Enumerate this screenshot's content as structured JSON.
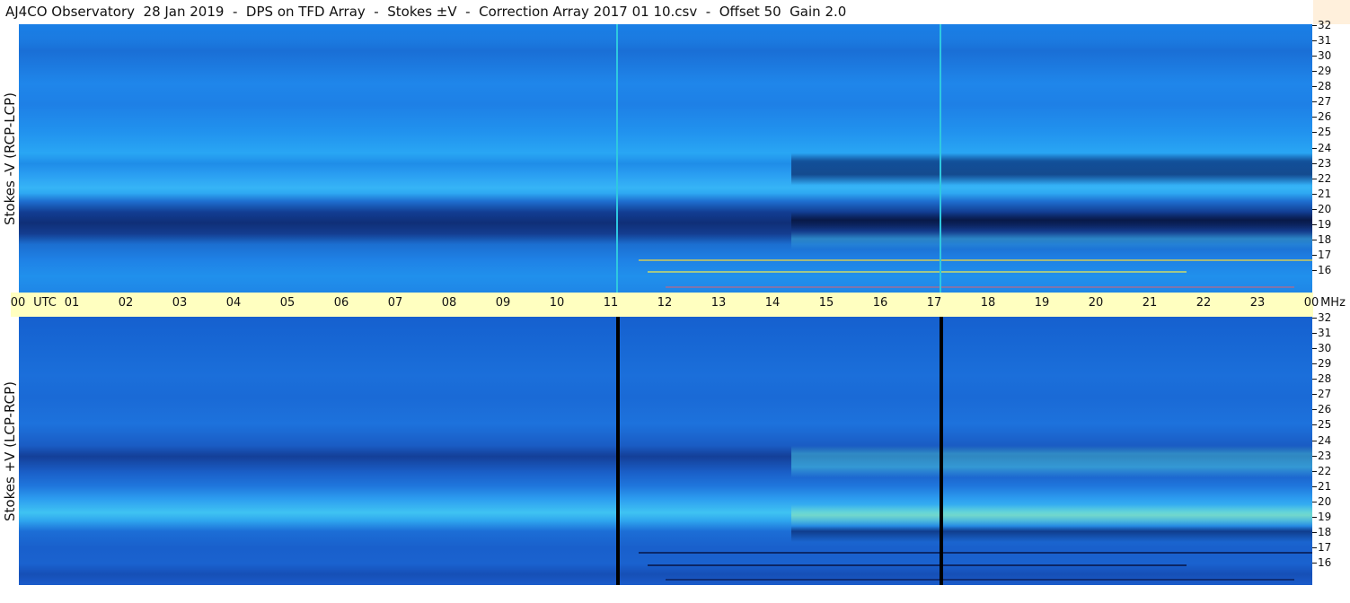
{
  "header": {
    "title": "AJ4CO Observatory  28 Jan 2019  -  DPS on TFD Array  -  Stokes ±V  -  Correction Array 2017 01 10.csv  -  Offset 50  Gain 2.0"
  },
  "panels": {
    "top_label": "Stokes -V (RCP-LCP)",
    "bottom_label": "Stokes +V (LCP-RCP)"
  },
  "time_axis": {
    "labels": [
      "00",
      "UTC",
      "01",
      "02",
      "03",
      "04",
      "05",
      "06",
      "07",
      "08",
      "09",
      "10",
      "11",
      "12",
      "13",
      "14",
      "15",
      "16",
      "17",
      "18",
      "19",
      "20",
      "21",
      "22",
      "23",
      "00",
      "MHz"
    ]
  },
  "freq_axis": {
    "labels": [
      "32",
      "31",
      "30",
      "29",
      "28",
      "27",
      "26",
      "25",
      "24",
      "23",
      "22",
      "21",
      "20",
      "19",
      "18",
      "17",
      "16"
    ]
  },
  "colors": {
    "title_bg": "#ffffff",
    "tick_bar_bg": "#ffffc0",
    "top_marker_line": "#2ec8e0",
    "bottom_marker_line": "#000000"
  }
}
